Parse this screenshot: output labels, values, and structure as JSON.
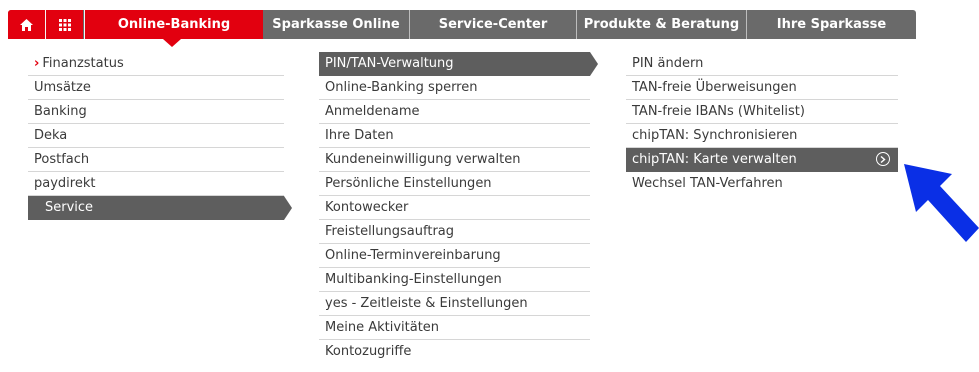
{
  "topnav": {
    "home_icon": "home-icon",
    "grid_icon": "apps-grid-icon",
    "tabs": [
      {
        "label": "Online-Banking",
        "active": true
      },
      {
        "label": "Sparkasse Online",
        "active": false
      },
      {
        "label": "Service-Center",
        "active": false
      },
      {
        "label": "Produkte & Beratung",
        "active": false
      },
      {
        "label": "Ihre Sparkasse",
        "active": false
      }
    ]
  },
  "col1": {
    "marker": "›",
    "items": [
      {
        "label": "Finanzstatus"
      },
      {
        "label": "Umsätze"
      },
      {
        "label": "Banking"
      },
      {
        "label": "Deka"
      },
      {
        "label": "Postfach"
      },
      {
        "label": "paydirekt"
      },
      {
        "label": "Service"
      }
    ]
  },
  "col2": {
    "items": [
      {
        "label": "PIN/TAN-Verwaltung"
      },
      {
        "label": "Online-Banking sperren"
      },
      {
        "label": "Anmeldename"
      },
      {
        "label": "Ihre Daten"
      },
      {
        "label": "Kundeneinwilligung verwalten"
      },
      {
        "label": "Persönliche Einstellungen"
      },
      {
        "label": "Kontowecker"
      },
      {
        "label": "Freistellungsauftrag"
      },
      {
        "label": "Online-Terminvereinbarung"
      },
      {
        "label": "Multibanking-Einstellungen"
      },
      {
        "label": "yes - Zeitleiste & Einstellungen"
      },
      {
        "label": "Meine Aktivitäten"
      },
      {
        "label": "Kontozugriffe"
      }
    ]
  },
  "col3": {
    "items": [
      {
        "label": "PIN ändern"
      },
      {
        "label": "TAN-freie Überweisungen"
      },
      {
        "label": "TAN-freie IBANs (Whitelist)"
      },
      {
        "label": "chipTAN: Synchronisieren"
      },
      {
        "label": "chipTAN: Karte verwalten"
      },
      {
        "label": "Wechsel TAN-Verfahren"
      }
    ]
  },
  "colors": {
    "brand_red": "#e2000f",
    "nav_gray": "#6a6a6a",
    "selected_gray": "#5e5e5e",
    "pointer_blue": "#0a2fe6"
  }
}
